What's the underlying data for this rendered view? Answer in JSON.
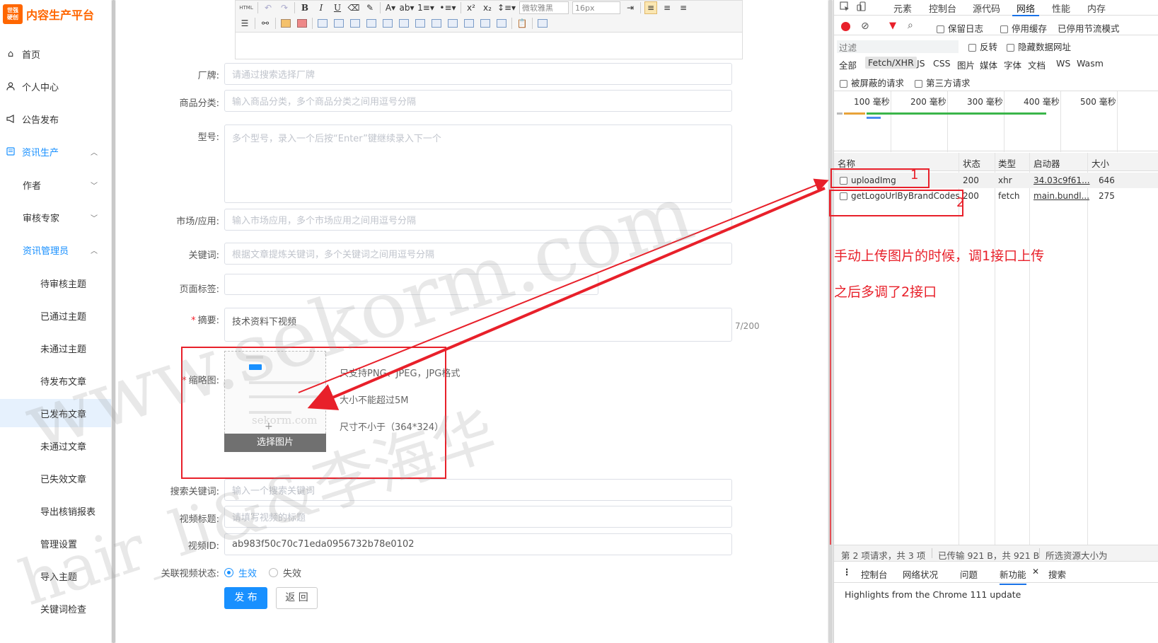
{
  "sidebar": {
    "logo_badge_line1": "世强",
    "logo_badge_line2": "硬创",
    "logo_text": "内容生产平台",
    "items": [
      {
        "label": "首页",
        "icon": "home-icon"
      },
      {
        "label": "个人中心",
        "icon": "user-icon"
      },
      {
        "label": "公告发布",
        "icon": "megaphone-icon"
      },
      {
        "label": "资讯生产",
        "icon": "news-icon"
      },
      {
        "label": "作者"
      },
      {
        "label": "审核专家"
      },
      {
        "label": "资讯管理员"
      }
    ],
    "leaves": [
      "待审核主题",
      "已通过主题",
      "未通过主题",
      "待发布文章",
      "已发布文章",
      "未通过文章",
      "已失效文章",
      "导出核销报表",
      "管理设置",
      "导入主题",
      "关键词检查"
    ]
  },
  "editor_toolbar": {
    "html_label": "HTML",
    "font_family": "微软雅黑",
    "font_size": "16px"
  },
  "form": {
    "brand": {
      "label": "厂牌:",
      "placeholder": "请通过搜索选择厂牌"
    },
    "category": {
      "label": "商品分类:",
      "placeholder": "输入商品分类，多个商品分类之间用逗号分隔"
    },
    "model": {
      "label": "型号:",
      "placeholder": "多个型号，录入一个后按“Enter”键继续录入下一个"
    },
    "market": {
      "label": "市场/应用:",
      "placeholder": "输入市场应用，多个市场应用之间用逗号分隔"
    },
    "keywords": {
      "label": "关键词:",
      "placeholder": "根据文章提炼关键词，多个关键词之间用逗号分隔"
    },
    "page_tag": {
      "label": "页面标签:"
    },
    "summary": {
      "label": "摘要:",
      "value": "技术资料下视频",
      "counter": "7/200"
    },
    "thumbnail": {
      "label": "缩略图:",
      "button": "选择图片",
      "hints": [
        "只支持PNG、JPEG，JPG格式",
        "大小不能超过5M",
        "尺寸不小于（364*324）"
      ]
    },
    "search_keyword": {
      "label": "搜索关键词:",
      "placeholder": "输入一个搜索关键词"
    },
    "video_title": {
      "label": "视频标题:",
      "placeholder": "请填写视频的标题"
    },
    "video_id": {
      "label": "视频ID:",
      "value": "ab983f50c70c71eda0956732b78e0102"
    },
    "video_status": {
      "label": "关联视频状态:",
      "options": [
        "生效",
        "失效"
      ],
      "selected": "生效"
    },
    "publish_button": "发 布",
    "back_button": "返 回"
  },
  "devtools": {
    "tabs": [
      "元素",
      "控制台",
      "源代码",
      "网络",
      "性能",
      "内存"
    ],
    "active_tab": "网络",
    "toolbar": {
      "preserve_log": "保留日志",
      "disable_cache": "停用缓存",
      "throttle": "已停用节流模式"
    },
    "filter": {
      "placeholder": "过滤",
      "invert": "反转",
      "hide_data_urls": "隐藏数据网址"
    },
    "types": [
      "全部",
      "Fetch/XHR",
      "JS",
      "CSS",
      "图片",
      "媒体",
      "字体",
      "文档",
      "WS",
      "Wasm"
    ],
    "active_type": "Fetch/XHR",
    "extra_filters": [
      "被屏蔽的请求",
      "第三方请求"
    ],
    "timeline_labels": [
      "100 毫秒",
      "200 毫秒",
      "300 毫秒",
      "400 毫秒",
      "500 毫秒"
    ],
    "columns": [
      "名称",
      "状态",
      "类型",
      "启动器",
      "大小"
    ],
    "rows": [
      {
        "name": "uploadImg",
        "status": "200",
        "type": "xhr",
        "initiator": "34.03c9f61...",
        "size": "646"
      },
      {
        "name": "getLogoUrlByBrandCodes",
        "status": "200",
        "type": "fetch",
        "initiator": "main.bundl...",
        "size": "275"
      }
    ],
    "status_bar": {
      "requests": "第 2 项请求，共 3 项",
      "transferred": "已传输 921 B，共 921 B",
      "resources": "所选资源大小为"
    },
    "drawer_tabs": [
      "控制台",
      "网络状况",
      "问题",
      "新功能",
      "搜索"
    ],
    "drawer_active": "新功能",
    "drawer_text": "Highlights from the Chrome 111 update"
  },
  "annotations": {
    "num1": "1",
    "num2": "2",
    "note_line1": "手动上传图片的时候，调1接口上传",
    "note_line2": "之后多调了2接口",
    "color": "#e8202a"
  },
  "watermarks": {
    "site": "www.sekorm.com",
    "author": "hair_li&&李海华",
    "thumb_site": "sekorm.com"
  },
  "colors": {
    "accent": "#1890ff",
    "logo": "#ff6600",
    "annotation": "#e8202a"
  }
}
